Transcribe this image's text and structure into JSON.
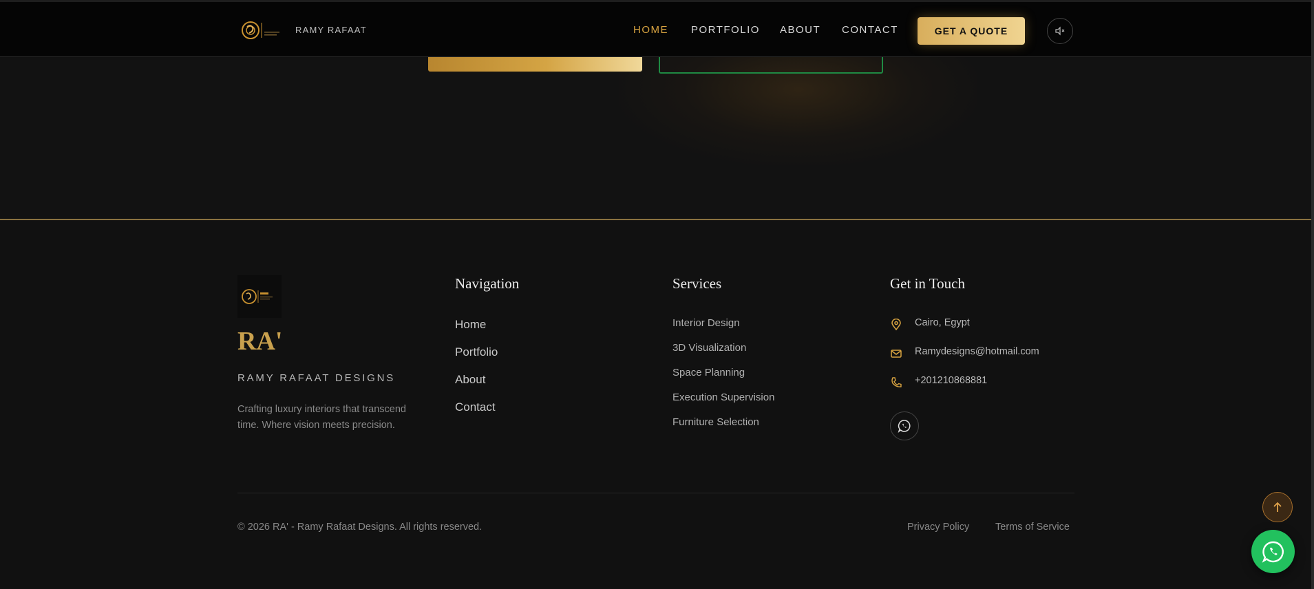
{
  "header": {
    "brand_name": "RAMY RAFAAT",
    "logo_mark_text": "RA'",
    "nav": [
      {
        "label": "HOME",
        "active": true
      },
      {
        "label": "PORTFOLIO",
        "active": false
      },
      {
        "label": "ABOUT",
        "active": false
      },
      {
        "label": "CONTACT",
        "active": false
      }
    ],
    "quote_button": "GET A QUOTE",
    "sound_icon": "speaker-muted-icon"
  },
  "footer": {
    "brand": {
      "wordmark": "RA'",
      "subtitle": "RAMY RAFAAT DESIGNS",
      "description": "Crafting luxury interiors that transcend time. Where vision meets precision."
    },
    "navigation": {
      "title": "Navigation",
      "links": [
        "Home",
        "Portfolio",
        "About",
        "Contact"
      ]
    },
    "services": {
      "title": "Services",
      "items": [
        "Interior Design",
        "3D Visualization",
        "Space Planning",
        "Execution Supervision",
        "Furniture Selection"
      ]
    },
    "contact": {
      "title": "Get in Touch",
      "location": "Cairo, Egypt",
      "email": "Ramydesigns@hotmail.com",
      "phone": "+201210868881"
    },
    "copyright": "© 2026 RA' - Ramy Rafaat Designs. All rights reserved.",
    "legal": [
      "Privacy Policy",
      "Terms of Service"
    ]
  },
  "colors": {
    "gold": "#d9a441",
    "whatsapp": "#22c15e",
    "background": "#111111"
  }
}
